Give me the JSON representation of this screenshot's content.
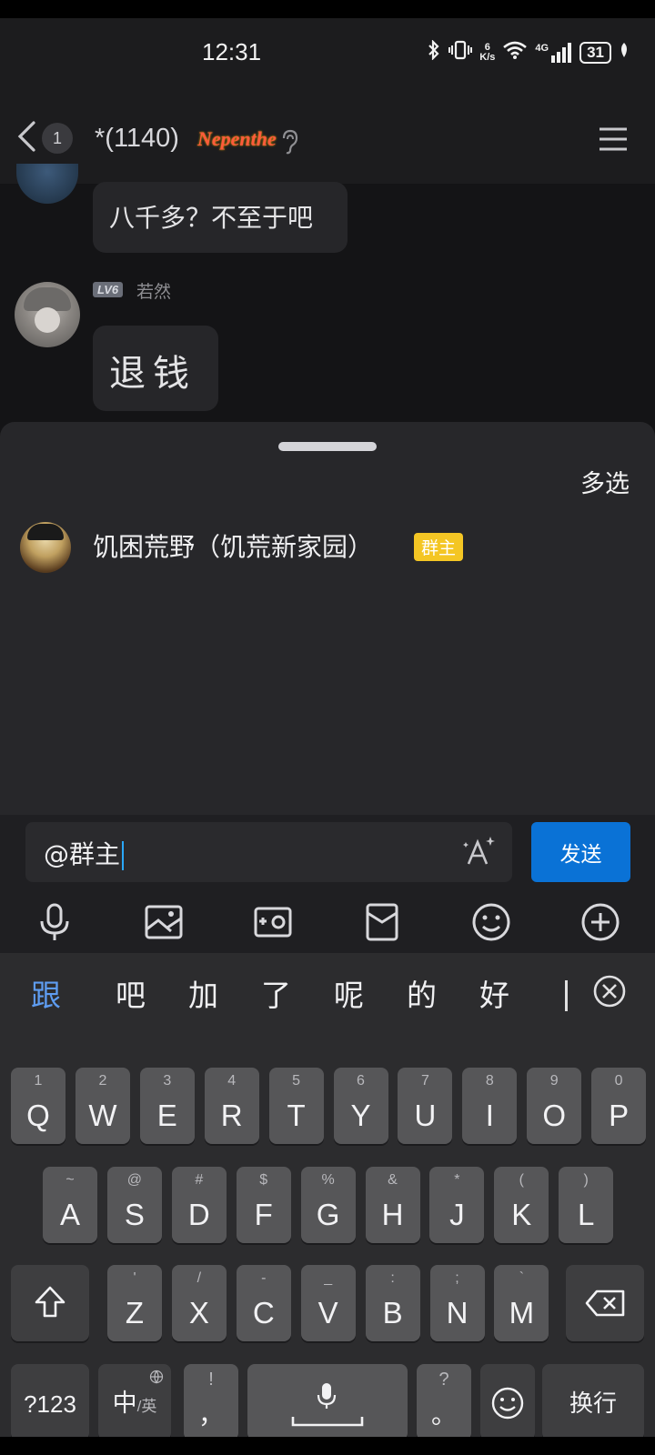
{
  "status_bar": {
    "time": "12:31",
    "net_speed_value": "6",
    "net_speed_unit": "K/s",
    "network": "4G",
    "battery": "31"
  },
  "header": {
    "unread_count": "1",
    "title": "*(1140)",
    "title_decoration": "Nepenthe"
  },
  "messages": [
    {
      "text": "八千多？不至于吧"
    },
    {
      "level": "LV6",
      "sender": "若然",
      "text": "退钱"
    }
  ],
  "mention_sheet": {
    "multi_select_label": "多选",
    "members": [
      {
        "name": "饥困荒野（饥荒新家园）",
        "role_badge": "群主"
      }
    ]
  },
  "composer": {
    "input_value": "@群主",
    "send_label": "发送"
  },
  "toolbar_icons": [
    "microphone-icon",
    "image-icon",
    "camera-icon",
    "red-packet-icon",
    "emoji-icon",
    "plus-icon"
  ],
  "keyboard": {
    "candidates": [
      "跟",
      "吧",
      "加",
      "了",
      "呢",
      "的",
      "好"
    ],
    "row1": [
      {
        "main": "Q",
        "sub": "1"
      },
      {
        "main": "W",
        "sub": "2"
      },
      {
        "main": "E",
        "sub": "3"
      },
      {
        "main": "R",
        "sub": "4"
      },
      {
        "main": "T",
        "sub": "5"
      },
      {
        "main": "Y",
        "sub": "6"
      },
      {
        "main": "U",
        "sub": "7"
      },
      {
        "main": "I",
        "sub": "8"
      },
      {
        "main": "O",
        "sub": "9"
      },
      {
        "main": "P",
        "sub": "0"
      }
    ],
    "row2": [
      {
        "main": "A",
        "sub": "~"
      },
      {
        "main": "S",
        "sub": "@"
      },
      {
        "main": "D",
        "sub": "#"
      },
      {
        "main": "F",
        "sub": "$"
      },
      {
        "main": "G",
        "sub": "%"
      },
      {
        "main": "H",
        "sub": "&"
      },
      {
        "main": "J",
        "sub": "*"
      },
      {
        "main": "K",
        "sub": "("
      },
      {
        "main": "L",
        "sub": ")"
      }
    ],
    "row3": [
      {
        "main": "Z",
        "sub": "'"
      },
      {
        "main": "X",
        "sub": "/"
      },
      {
        "main": "C",
        "sub": "-"
      },
      {
        "main": "V",
        "sub": "_"
      },
      {
        "main": "B",
        "sub": ":"
      },
      {
        "main": "N",
        "sub": ";"
      },
      {
        "main": "M",
        "sub": "`"
      }
    ],
    "symbols_label": "?123",
    "lang_main": "中",
    "lang_sub": "/英",
    "comma_main": "，",
    "comma_sub": "!",
    "period_main": "。",
    "period_sub": "?",
    "enter_label": "换行"
  }
}
